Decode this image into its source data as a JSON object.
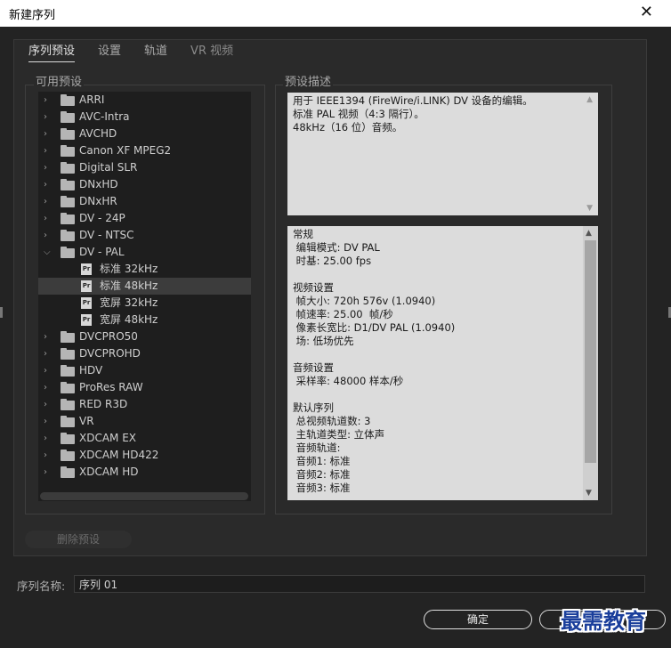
{
  "window": {
    "title": "新建序列",
    "close_glyph": "✕"
  },
  "tabs": [
    "序列预设",
    "设置",
    "轨道",
    "VR 视频"
  ],
  "available_presets_label": "可用预设",
  "preset_desc_label": "预设描述",
  "tree": [
    {
      "label": "ARRI",
      "type": "folder",
      "expanded": false
    },
    {
      "label": "AVC-Intra",
      "type": "folder",
      "expanded": false
    },
    {
      "label": "AVCHD",
      "type": "folder",
      "expanded": false
    },
    {
      "label": "Canon XF MPEG2",
      "type": "folder",
      "expanded": false
    },
    {
      "label": "Digital SLR",
      "type": "folder",
      "expanded": false
    },
    {
      "label": "DNxHD",
      "type": "folder",
      "expanded": false
    },
    {
      "label": "DNxHR",
      "type": "folder",
      "expanded": false
    },
    {
      "label": "DV - 24P",
      "type": "folder",
      "expanded": false
    },
    {
      "label": "DV - NTSC",
      "type": "folder",
      "expanded": false
    },
    {
      "label": "DV - PAL",
      "type": "folder",
      "expanded": true
    },
    {
      "label": "标准 32kHz",
      "type": "preset"
    },
    {
      "label": "标准 48kHz",
      "type": "preset",
      "selected": true
    },
    {
      "label": "宽屏 32kHz",
      "type": "preset"
    },
    {
      "label": "宽屏 48kHz",
      "type": "preset"
    },
    {
      "label": "DVCPRO50",
      "type": "folder",
      "expanded": false
    },
    {
      "label": "DVCPROHD",
      "type": "folder",
      "expanded": false
    },
    {
      "label": "HDV",
      "type": "folder",
      "expanded": false
    },
    {
      "label": "ProRes RAW",
      "type": "folder",
      "expanded": false
    },
    {
      "label": "RED R3D",
      "type": "folder",
      "expanded": false
    },
    {
      "label": "VR",
      "type": "folder",
      "expanded": false
    },
    {
      "label": "XDCAM EX",
      "type": "folder",
      "expanded": false
    },
    {
      "label": "XDCAM HD422",
      "type": "folder",
      "expanded": false
    },
    {
      "label": "XDCAM HD",
      "type": "folder",
      "expanded": false
    }
  ],
  "preset_file_icon_text": "Pr",
  "description_lines": [
    "用于 IEEE1394 (FireWire/i.LINK) DV 设备的编辑。",
    "标准 PAL 视频（4:3 隔行）。",
    "48kHz（16 位）音频。"
  ],
  "details_lines": [
    "常规",
    " 编辑模式: DV PAL",
    " 时基: 25.00 fps",
    "",
    "视频设置",
    " 帧大小: 720h 576v (1.0940)",
    " 帧速率: 25.00  帧/秒",
    " 像素长宽比: D1/DV PAL (1.0940)",
    " 场: 低场优先",
    "",
    "音频设置",
    " 采样率: 48000 样本/秒",
    "",
    "默认序列",
    " 总视频轨道数: 3",
    " 主轨道类型: 立体声",
    " 音频轨道:",
    " 音频1: 标准",
    " 音频2: 标准",
    " 音频3: 标准"
  ],
  "delete_preset_label": "删除预设",
  "sequence_name_label": "序列名称:",
  "sequence_name_value": "序列 01",
  "ok_label": "确定",
  "watermark_text": "最需教育",
  "colors": {
    "background": "#232323",
    "panel": "#2a2a2a",
    "text_box": "#dcdcdc",
    "watermark": "#1a3e9b"
  }
}
